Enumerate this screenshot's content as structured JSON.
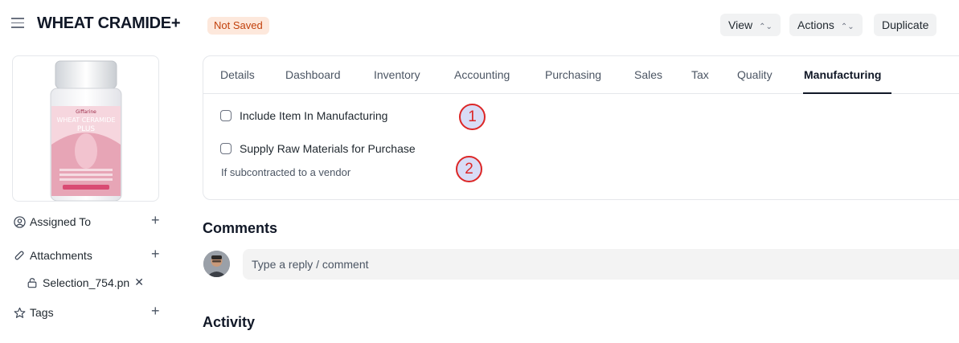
{
  "header": {
    "title": "WHEAT CRAMIDE+",
    "status_badge": "Not Saved",
    "buttons": {
      "view": "View",
      "actions": "Actions",
      "duplicate": "Duplicate"
    }
  },
  "product_image": {
    "brand": "Giffarine",
    "line1": "WHEAT CERAMIDE",
    "line2": "PLUS"
  },
  "sidebar": {
    "assigned_to": "Assigned To",
    "attachments": "Attachments",
    "attachment_file": "Selection_754.pn",
    "tags": "Tags"
  },
  "tabs": [
    "Details",
    "Dashboard",
    "Inventory",
    "Accounting",
    "Purchasing",
    "Sales",
    "Tax",
    "Quality",
    "Manufacturing"
  ],
  "active_tab": "Manufacturing",
  "manufacturing": {
    "include_item_label": "Include Item In Manufacturing",
    "include_item_checked": false,
    "supply_raw_label": "Supply Raw Materials for Purchase",
    "supply_raw_checked": false,
    "supply_raw_hint": "If subcontracted to a vendor"
  },
  "markers": [
    "1",
    "2"
  ],
  "comments": {
    "title": "Comments",
    "placeholder": "Type a reply / comment"
  },
  "activity": {
    "title": "Activity"
  }
}
